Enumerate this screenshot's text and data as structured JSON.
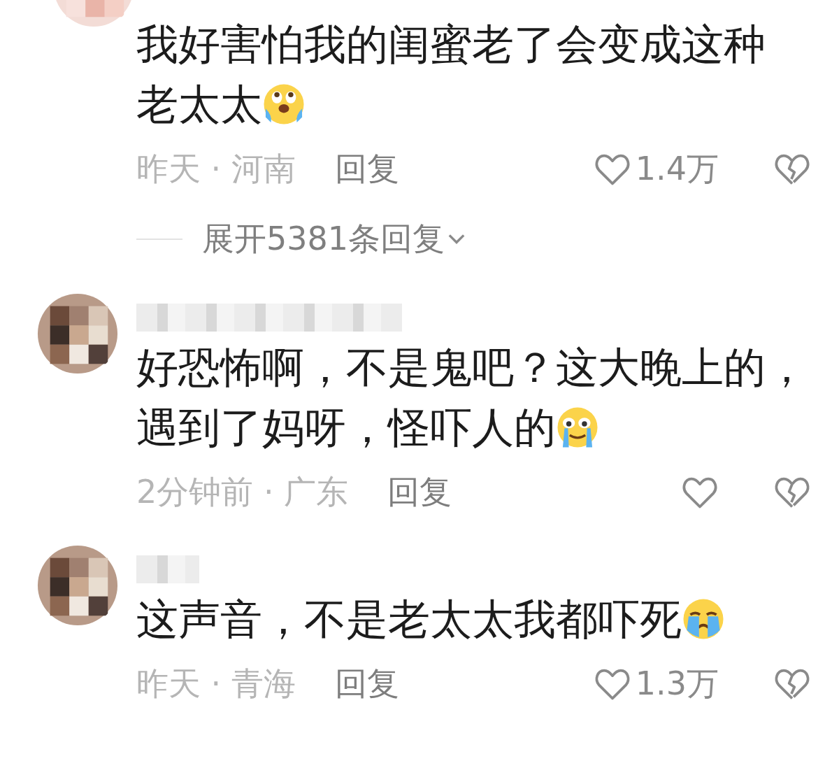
{
  "comments": [
    {
      "name_blurred": false,
      "avatar_cut": true,
      "lines": [
        "我好害怕我的闺蜜老了会变成这种",
        "老太太"
      ],
      "time_location": "昨天 · 河南",
      "reply": "回复",
      "likes": "1.4万",
      "expand": "展开5381条回复"
    },
    {
      "name_blurred": true,
      "avatar_cut": false,
      "lines": [
        "好恐怖啊，不是鬼吧？这大晚上的，",
        "遇到了妈呀，怪吓人的"
      ],
      "time_location": "2分钟前 · 广东",
      "reply": "回复"
    },
    {
      "name_blurred": true,
      "avatar_cut": false,
      "lines": [
        "这声音，不是老太太我都吓死"
      ],
      "time_location": "昨天 · 青海",
      "reply": "回复",
      "likes": "1.3万"
    }
  ]
}
